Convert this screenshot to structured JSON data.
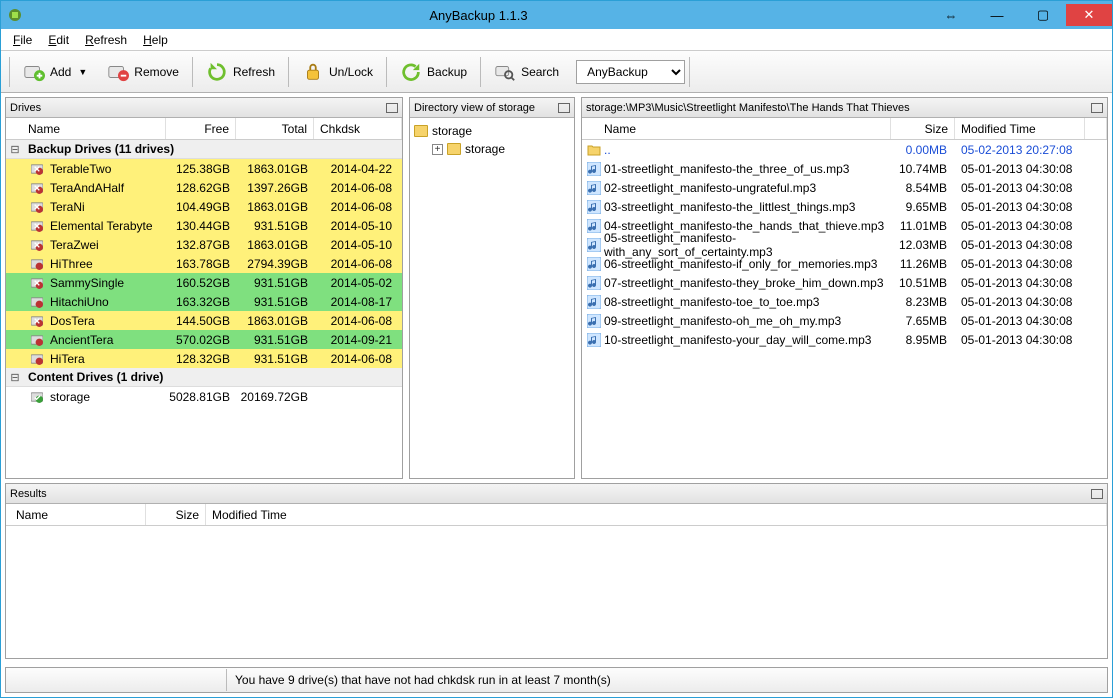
{
  "title": "AnyBackup 1.1.3",
  "menu": {
    "file": "File",
    "edit": "Edit",
    "refresh": "Refresh",
    "help": "Help"
  },
  "toolbar": {
    "add": "Add",
    "remove": "Remove",
    "refresh": "Refresh",
    "unlock": "Un/Lock",
    "backup": "Backup",
    "search": "Search",
    "select": "AnyBackup"
  },
  "panes": {
    "drives": {
      "title": "Drives",
      "cols": {
        "name": "Name",
        "free": "Free",
        "total": "Total",
        "chkdsk": "Chkdsk"
      },
      "group1": "Backup Drives (11 drives)",
      "group2": "Content Drives (1 drive)",
      "rows": [
        {
          "name": "TerableTwo",
          "free": "125.38GB",
          "total": "1863.01GB",
          "chkdsk": "2014-04-22",
          "hl": "yellow",
          "bad": true
        },
        {
          "name": "TeraAndAHalf",
          "free": "128.62GB",
          "total": "1397.26GB",
          "chkdsk": "2014-06-08",
          "hl": "yellow",
          "bad": true
        },
        {
          "name": "TeraNi",
          "free": "104.49GB",
          "total": "1863.01GB",
          "chkdsk": "2014-06-08",
          "hl": "yellow",
          "bad": true
        },
        {
          "name": "Elemental Terabyte",
          "free": "130.44GB",
          "total": "931.51GB",
          "chkdsk": "2014-05-10",
          "hl": "yellow",
          "bad": true
        },
        {
          "name": "TeraZwei",
          "free": "132.87GB",
          "total": "1863.01GB",
          "chkdsk": "2014-05-10",
          "hl": "yellow",
          "bad": true
        },
        {
          "name": "HiThree",
          "free": "163.78GB",
          "total": "2794.39GB",
          "chkdsk": "2014-06-08",
          "hl": "yellow",
          "bad": false
        },
        {
          "name": "SammySingle",
          "free": "160.52GB",
          "total": "931.51GB",
          "chkdsk": "2014-05-02",
          "hl": "green",
          "bad": true
        },
        {
          "name": "HitachiUno",
          "free": "163.32GB",
          "total": "931.51GB",
          "chkdsk": "2014-08-17",
          "hl": "green",
          "bad": false
        },
        {
          "name": "DosTera",
          "free": "144.50GB",
          "total": "1863.01GB",
          "chkdsk": "2014-06-08",
          "hl": "yellow",
          "bad": true
        },
        {
          "name": "AncientTera",
          "free": "570.02GB",
          "total": "931.51GB",
          "chkdsk": "2014-09-21",
          "hl": "green",
          "bad": false
        },
        {
          "name": "HiTera",
          "free": "128.32GB",
          "total": "931.51GB",
          "chkdsk": "2014-06-08",
          "hl": "yellow",
          "bad": false
        }
      ],
      "content": [
        {
          "name": "storage",
          "free": "5028.81GB",
          "total": "20169.72GB",
          "chkdsk": "",
          "hl": "",
          "bad": false,
          "ok": true
        }
      ]
    },
    "tree": {
      "title": "Directory view of storage",
      "root": "storage",
      "child": "storage"
    },
    "files": {
      "title": "storage:\\MP3\\Music\\Streetlight Manifesto\\The Hands That Thieves",
      "cols": {
        "name": "Name",
        "size": "Size",
        "mtime": "Modified Time"
      },
      "parent": {
        "name": "..",
        "size": "0.00MB",
        "mtime": "05-02-2013 20:27:08"
      },
      "rows": [
        {
          "name": "01-streetlight_manifesto-the_three_of_us.mp3",
          "size": "10.74MB",
          "mtime": "05-01-2013 04:30:08"
        },
        {
          "name": "02-streetlight_manifesto-ungrateful.mp3",
          "size": "8.54MB",
          "mtime": "05-01-2013 04:30:08"
        },
        {
          "name": "03-streetlight_manifesto-the_littlest_things.mp3",
          "size": "9.65MB",
          "mtime": "05-01-2013 04:30:08"
        },
        {
          "name": "04-streetlight_manifesto-the_hands_that_thieve.mp3",
          "size": "11.01MB",
          "mtime": "05-01-2013 04:30:08"
        },
        {
          "name": "05-streetlight_manifesto-with_any_sort_of_certainty.mp3",
          "size": "12.03MB",
          "mtime": "05-01-2013 04:30:08"
        },
        {
          "name": "06-streetlight_manifesto-if_only_for_memories.mp3",
          "size": "11.26MB",
          "mtime": "05-01-2013 04:30:08"
        },
        {
          "name": "07-streetlight_manifesto-they_broke_him_down.mp3",
          "size": "10.51MB",
          "mtime": "05-01-2013 04:30:08"
        },
        {
          "name": "08-streetlight_manifesto-toe_to_toe.mp3",
          "size": "8.23MB",
          "mtime": "05-01-2013 04:30:08"
        },
        {
          "name": "09-streetlight_manifesto-oh_me_oh_my.mp3",
          "size": "7.65MB",
          "mtime": "05-01-2013 04:30:08"
        },
        {
          "name": "10-streetlight_manifesto-your_day_will_come.mp3",
          "size": "8.95MB",
          "mtime": "05-01-2013 04:30:08"
        }
      ]
    },
    "results": {
      "title": "Results",
      "cols": {
        "name": "Name",
        "size": "Size",
        "mtime": "Modified Time"
      }
    }
  },
  "status": "You have 9 drive(s) that have not had chkdsk run in at least 7 month(s)"
}
